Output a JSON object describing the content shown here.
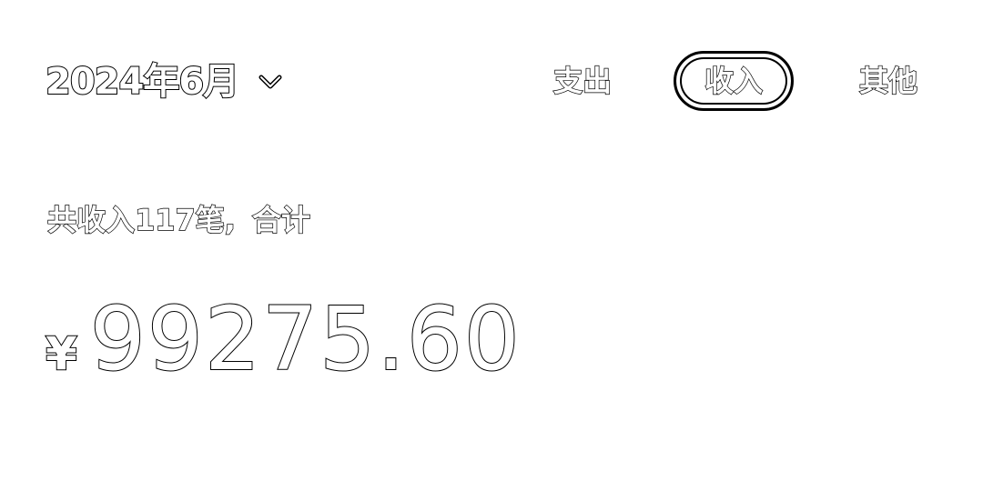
{
  "header": {
    "month": "2024年6月"
  },
  "tabs": [
    {
      "label": "支出",
      "selected": false
    },
    {
      "label": "收入",
      "selected": true
    },
    {
      "label": "其他",
      "selected": false
    }
  ],
  "summary": {
    "count_text": "共收入117笔,",
    "total_label": "合计"
  },
  "amount": {
    "currency": "¥",
    "value": "99275.60"
  },
  "icons": {
    "month_dropdown": "chevron-down-icon"
  },
  "colors": {
    "background": "#ffffff",
    "outline": "#000000"
  }
}
